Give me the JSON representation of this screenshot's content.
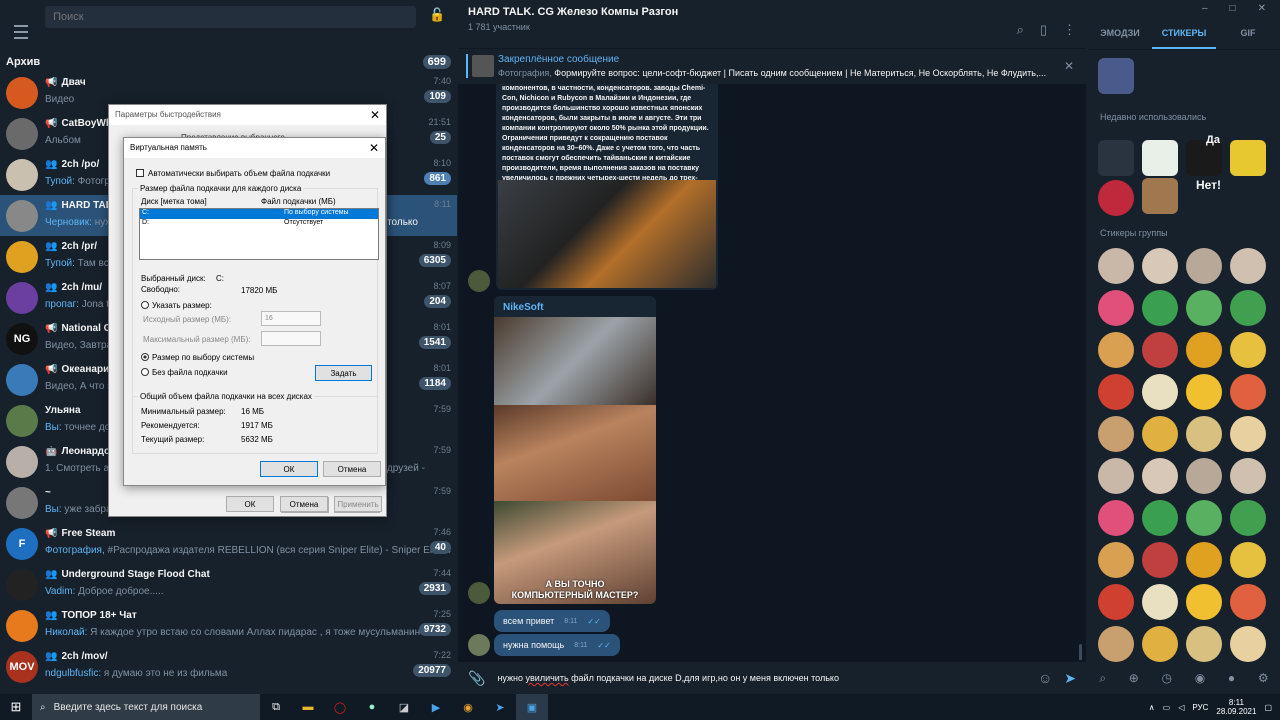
{
  "window_controls": {
    "min": "–",
    "max": "□",
    "close": "✕"
  },
  "left": {
    "search_placeholder": "Поиск",
    "archive": {
      "label": "Архив",
      "count": "699"
    },
    "chats": [
      {
        "name": "Двач",
        "prev_who": "",
        "prev": "Видео",
        "time": "7:40",
        "badge": "109",
        "icon": "megaphone",
        "color": "#d65a1f",
        "initials": ""
      },
      {
        "name": "CatBoyWhit",
        "prev_who": "",
        "prev": "Альбом",
        "time": "21:51",
        "badge": "25",
        "icon": "megaphone",
        "color": "#6a6a6a",
        "initials": ""
      },
      {
        "name": "2ch /po/",
        "prev_who": "Тупой:",
        "prev": " Фотогра",
        "time": "8:10",
        "badge": "861",
        "icon": "group",
        "color": "#c9c0b0",
        "initials": ""
      },
      {
        "name": "HARD TALK.",
        "prev_who": "Черновик:",
        "prev": " нуж",
        "time": "8:11",
        "badge": "",
        "icon": "group",
        "color": "#888",
        "initials": ""
      },
      {
        "name": "2ch /pr/",
        "prev_who": "Тупой:",
        "prev": " Там всег",
        "time": "8:09",
        "badge": "6305",
        "icon": "group",
        "color": "#e0a020",
        "initials": ""
      },
      {
        "name": "2ch /mu/",
        "prev_who": "пропаг:",
        "prev": " Jona th",
        "time": "8:07",
        "badge": "204",
        "icon": "group",
        "color": "#6a3fa0",
        "initials": ""
      },
      {
        "name": "National Ge",
        "prev_who": "",
        "prev": "Видео, Завтрак",
        "time": "8:01",
        "badge": "1541",
        "icon": "megaphone",
        "color": "#111",
        "initials": "NG"
      },
      {
        "name": "Океанариу",
        "prev_who": "",
        "prev": "Видео, А что эт",
        "time": "8:01",
        "badge": "1184",
        "icon": "megaphone",
        "color": "#3a7ab8",
        "initials": ""
      },
      {
        "name": "Ульяна",
        "prev_who": "Вы:",
        "prev": " точнее доб",
        "time": "7:59",
        "badge": "",
        "icon": "",
        "color": "#5a7a4a",
        "initials": ""
      },
      {
        "name": "Леонардо Д",
        "prev_who": "",
        "prev": "1. Смотреть ан",
        "time": "7:59",
        "badge": "",
        "icon": "bot",
        "color": "#b8b0a8",
        "initials": ""
      },
      {
        "name": "~",
        "prev_who": "Вы:",
        "prev": " уже забрал",
        "time": "7:59",
        "badge": "",
        "icon": "",
        "color": "#777",
        "initials": ""
      },
      {
        "name": "Free Steam",
        "prev_who": "Фотография,",
        "prev": " #Распродажа издателя REBELLION (вся серия Sniper Elite)  - Sniper Elite 4 — 104...",
        "time": "7:46",
        "badge": "40",
        "icon": "megaphone",
        "color": "#1e6fbf",
        "initials": "F"
      },
      {
        "name": "Underground Stage Flood Chat",
        "prev_who": "Vadim:",
        "prev": " Доброе доброе.....",
        "time": "7:44",
        "badge": "2931",
        "icon": "group",
        "color": "#222",
        "initials": ""
      },
      {
        "name": "ТОПОР 18+ Чат",
        "prev_who": "Николай:",
        "prev": " Я каждое утро встаю со словами Аллах пидарас , я тоже мусульманин",
        "time": "7:25",
        "badge": "9732",
        "icon": "group",
        "color": "#e87a1e",
        "initials": ""
      },
      {
        "name": "2ch /mov/",
        "prev_who": "ndgulbfusfic:",
        "prev": " я думаю это не из фильма",
        "time": "7:22",
        "badge": "20977",
        "icon": "group",
        "color": "#a8321e",
        "initials": "MOV"
      }
    ],
    "chat_extra": {
      "draft_tail": "чен только",
      "leonardo_tail": "аси друзей -"
    }
  },
  "chat": {
    "title": "HARD TALK. CG Железо Компы Разгон",
    "subtitle": "1 781 участник",
    "pinned_title": "Закреплённое сообщение",
    "pinned_kind": "Фотография,",
    "pinned_text": " Формируйте вопрос: цели-софт-бюджет | Писать одним сообщением | Не Материться, Не Оскорблять, Не Флудить,...",
    "post_text": "компонентов, в частности, конденсаторов. заводы Chemi-Con, Nichicon и Rubycon в Малайзии и Индонезии, где производится большинство хорошо известных японских конденсаторов, были закрыты в июле и августе. Эти три компании контролируют около 50% рынка этой продукции. Ограничения приведут к сокращению поставок конденсаторов на 30–60%. Даже с учетом того, что часть поставок смогут обеспечить тайваньские и китайские производители, время выполнения заказов на поставку увеличилось с прежних четырех-шести недель до трех-шести месяцев.",
    "sender": "NikeSoft",
    "gif_caption": "А ВЫ ТОЧНО\nКОМПЬЮТЕРНЫЙ МАСТЕР?",
    "messages": [
      {
        "text": "всем привет",
        "time": "8:11"
      },
      {
        "text": "нужна помощь",
        "time": "8:11"
      }
    ],
    "input_pre": "нужно ",
    "input_err": "увиличить",
    "input_post": " файл подкачки на диске D,для игр,но он у меня включен только"
  },
  "right": {
    "tabs": [
      "ЭМОДЗИ",
      "СТИКЕРЫ",
      "GIF"
    ],
    "recent_label": "Недавно использовались",
    "group_label": "Стикеры группы",
    "sticker_texts": {
      "da": "Да",
      "net": "Нет!"
    }
  },
  "perf_dialog": {
    "title": "Параметры быстродействия",
    "ok": "ОК",
    "cancel": "Отмена",
    "apply": "Применить",
    "behind": "Представление выбранного ..."
  },
  "vm_dialog": {
    "title": "Виртуальная память",
    "auto_label": "Автоматически выбирать объем файла подкачки",
    "group1": "Размер файла подкачки для каждого диска",
    "col_disk": "Диск [метка тома]",
    "col_size": "Файл подкачки (МБ)",
    "rows": [
      {
        "d": "C:",
        "s": "По выбору системы"
      },
      {
        "d": "D:",
        "s": "Отсутствует"
      }
    ],
    "sel_disk_label": "Выбранный диск:",
    "sel_disk": "C:",
    "free_label": "Свободно:",
    "free": "17820 МБ",
    "custom": "Указать размер:",
    "init_label": "Исходный размер (МБ):",
    "init_val": "16",
    "max_label": "Максимальный размер (МБ):",
    "system": "Размер по выбору системы",
    "none": "Без файла подкачки",
    "set": "Задать",
    "group2": "Общий объем файла подкачки на всех дисках",
    "min_label": "Минимальный размер:",
    "min": "16 МБ",
    "rec_label": "Рекомендуется:",
    "rec": "1917 МБ",
    "cur_label": "Текущий размер:",
    "cur": "5632 МБ",
    "ok": "ОК",
    "cancel": "Отмена"
  },
  "taskbar": {
    "search": "Введите здесь текст для поиска",
    "lang": "РУС",
    "time": "8:11",
    "date": "28.09.2021"
  }
}
